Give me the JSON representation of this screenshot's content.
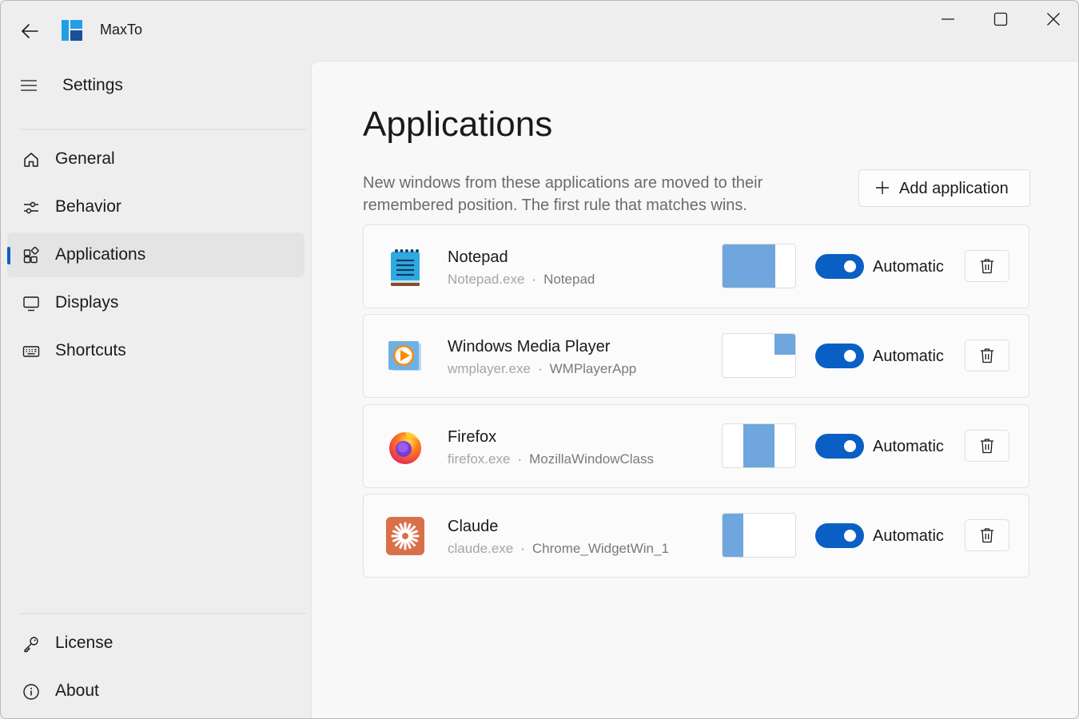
{
  "window": {
    "app_title": "MaxTo",
    "controls": [
      "minimize",
      "maximize",
      "close"
    ]
  },
  "sidebar": {
    "title": "Settings",
    "items": [
      {
        "label": "General",
        "icon": "home-icon",
        "selected": false
      },
      {
        "label": "Behavior",
        "icon": "sliders-icon",
        "selected": false
      },
      {
        "label": "Applications",
        "icon": "apps-icon",
        "selected": true
      },
      {
        "label": "Displays",
        "icon": "monitor-icon",
        "selected": false
      },
      {
        "label": "Shortcuts",
        "icon": "keyboard-icon",
        "selected": false
      }
    ],
    "footer_items": [
      {
        "label": "License",
        "icon": "key-icon"
      },
      {
        "label": "About",
        "icon": "info-icon"
      }
    ]
  },
  "main": {
    "title": "Applications",
    "description": "New windows from these applications are moved to their remembered position. The first rule that matches wins.",
    "add_button_label": "Add application",
    "applications": [
      {
        "name": "Notepad",
        "exe": "Notepad.exe",
        "window_class": "Notepad",
        "mode": "Automatic",
        "enabled": true,
        "icon": "notepad-icon",
        "layout_preview": "left-large"
      },
      {
        "name": "Windows Media Player",
        "exe": "wmplayer.exe",
        "window_class": "WMPlayerApp",
        "mode": "Automatic",
        "enabled": true,
        "icon": "media-player-icon",
        "layout_preview": "top-right-small"
      },
      {
        "name": "Firefox",
        "exe": "firefox.exe",
        "window_class": "MozillaWindowClass",
        "mode": "Automatic",
        "enabled": true,
        "icon": "firefox-icon",
        "layout_preview": "center-tall"
      },
      {
        "name": "Claude",
        "exe": "claude.exe",
        "window_class": "Chrome_WidgetWin_1",
        "mode": "Automatic",
        "enabled": true,
        "icon": "claude-icon",
        "layout_preview": "left-narrow"
      }
    ]
  },
  "colors": {
    "accent": "#0a5fc4",
    "layout_zone": "#6ea6dd",
    "secondary_text": "#6b6b6b"
  }
}
